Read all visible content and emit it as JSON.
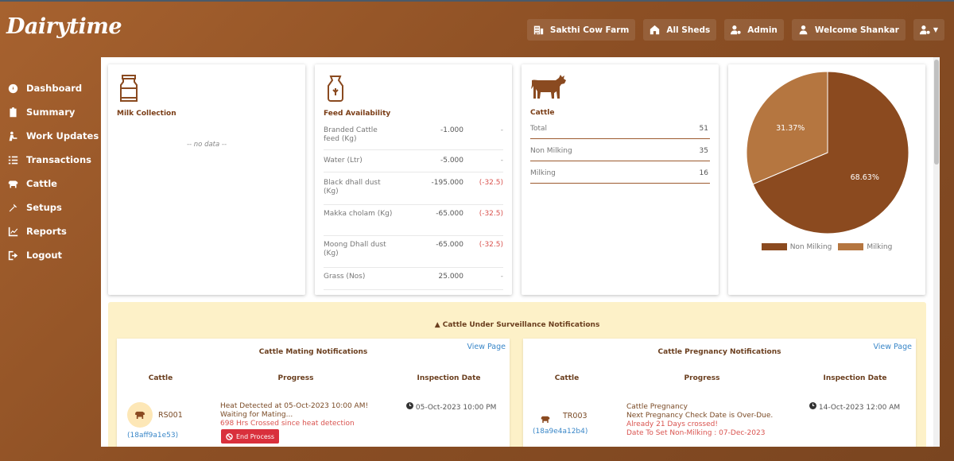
{
  "app": {
    "logo": "Dairytime"
  },
  "topbar": {
    "farm": "Sakthi Cow Farm",
    "sheds": "All Sheds",
    "role": "Admin",
    "welcome": "Welcome Shankar"
  },
  "sidebar": {
    "items": [
      {
        "label": "Dashboard",
        "icon": "dashboard-icon"
      },
      {
        "label": "Summary",
        "icon": "clipboard-icon"
      },
      {
        "label": "Work Updates",
        "icon": "worker-icon"
      },
      {
        "label": "Transactions",
        "icon": "list-icon"
      },
      {
        "label": "Cattle",
        "icon": "cow-icon"
      },
      {
        "label": "Setups",
        "icon": "tools-icon"
      },
      {
        "label": "Reports",
        "icon": "chart-icon"
      },
      {
        "label": "Logout",
        "icon": "logout-icon"
      }
    ]
  },
  "milk": {
    "title": "Milk Collection",
    "empty": "-- no data --"
  },
  "feed": {
    "title": "Feed Availability",
    "rows": [
      {
        "name": "Branded Cattle feed (Kg)",
        "value": "-1.000",
        "diff": "-"
      },
      {
        "name": "Water (Ltr)",
        "value": "-5.000",
        "diff": "-"
      },
      {
        "name": "Black dhall dust (Kg)",
        "value": "-195.000",
        "diff": "(-32.5)"
      },
      {
        "name": "Makka cholam (Kg)",
        "value": "-65.000",
        "diff": "(-32.5)"
      },
      {
        "name": "Moong Dhall dust (Kg)",
        "value": "-65.000",
        "diff": "(-32.5)"
      },
      {
        "name": "Grass (Nos)",
        "value": "25.000",
        "diff": "-"
      }
    ]
  },
  "cattle": {
    "title": "Cattle",
    "rows": [
      {
        "label": "Total",
        "value": "51"
      },
      {
        "label": "Non Milking",
        "value": "35"
      },
      {
        "label": "Milking",
        "value": "16"
      }
    ]
  },
  "pie": {
    "slices": [
      {
        "label": "Non Milking",
        "value": 68.63,
        "text": "68.63%",
        "color": "#8b4a1f"
      },
      {
        "label": "Milking",
        "value": 31.37,
        "text": "31.37%",
        "color": "#b57640"
      }
    ]
  },
  "surveillance": {
    "title": "Cattle Under Surveillance Notifications"
  },
  "mating": {
    "title": "Cattle Mating Notifications",
    "view": "View Page",
    "headers": {
      "cattle": "Cattle",
      "progress": "Progress",
      "date": "Inspection Date"
    },
    "row": {
      "tag": "RS001",
      "id": "(18aff9a1e53)",
      "line1": "Heat Detected at 05-Oct-2023 10:00 AM!",
      "line2": "Waiting for Mating...",
      "line3": "698 Hrs Crossed since heat detection",
      "button": "End Process",
      "date": "05-Oct-2023 10:00 PM"
    }
  },
  "pregnancy": {
    "title": "Cattle Pregnancy Notifications",
    "view": "View Page",
    "headers": {
      "cattle": "Cattle",
      "progress": "Progress",
      "date": "Inspection Date"
    },
    "row": {
      "tag": "TR003",
      "id": "(18a9e4a12b4)",
      "line1": "Cattle Pregnancy",
      "line2": "Next Pregnancy Check Date is Over-Due.",
      "line3": "Already 21 Days crossed!",
      "line4": "Date To Set Non-Milking : 07-Dec-2023",
      "date": "14-Oct-2023 12:00 AM"
    }
  }
}
